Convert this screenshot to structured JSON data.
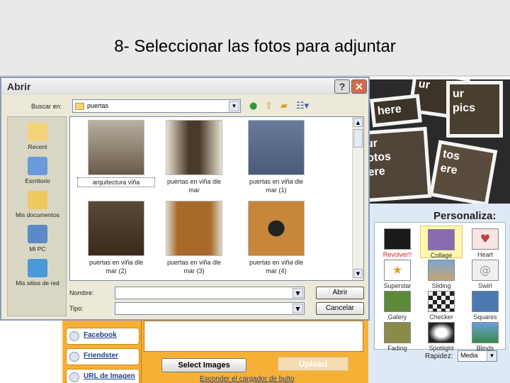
{
  "slide": {
    "title": "8- Seleccionar las fotos para adjuntar"
  },
  "dialog": {
    "title": "Abrir",
    "help": "?",
    "close": "✕",
    "lookin_label": "Buscar en:",
    "lookin_value": "puertas",
    "places": [
      {
        "label": "Recent",
        "icon": "recent-folder-icon"
      },
      {
        "label": "Escritorio",
        "icon": "desktop-icon"
      },
      {
        "label": "Mis documentos",
        "icon": "documents-folder-icon"
      },
      {
        "label": "Mi PC",
        "icon": "computer-icon"
      },
      {
        "label": "Mis sitios de red",
        "icon": "network-icon"
      }
    ],
    "files": [
      {
        "line1": "arquitectura viña",
        "line2": ""
      },
      {
        "line1": "puertas en viña dle",
        "line2": "mar"
      },
      {
        "line1": "puertas en viña dle",
        "line2": "mar (1)"
      },
      {
        "line1": "puertas en viña dle",
        "line2": "mar (2)"
      },
      {
        "line1": "puertas en viña dle",
        "line2": "mar (3)"
      },
      {
        "line1": "puertas en viña dle",
        "line2": "mar (4)"
      }
    ],
    "filename_label": "Nombre:",
    "filename_value": "",
    "filetype_label": "Tipo:",
    "filetype_value": "",
    "open_button": "Abrir",
    "cancel_button": "Cancelar"
  },
  "background_page": {
    "photo_texts": [
      "ur",
      "ur\npics",
      "here",
      "ur\notos\nere",
      "tos\nere"
    ],
    "personaliza": "Personaliza:",
    "effects": [
      {
        "label": "Revolver!!",
        "highlight": "#d02020"
      },
      {
        "label": "Collage",
        "selected": true
      },
      {
        "label": "Heart"
      },
      {
        "label": "Superstar"
      },
      {
        "label": "Sliding"
      },
      {
        "label": "Swirl"
      },
      {
        "label": "Galery"
      },
      {
        "label": "Checker"
      },
      {
        "label": "Squares"
      },
      {
        "label": "Fading"
      },
      {
        "label": "Spotlight"
      },
      {
        "label": "Blinds"
      }
    ],
    "rapidez_label": "Rapidez:",
    "rapidez_value": "Media",
    "social": [
      "Facebook",
      "Friendster",
      "URL de Imagen"
    ],
    "select_images": "Select Images",
    "upload": "Upload",
    "hide_link": "Esconder el cargador de bulto"
  }
}
